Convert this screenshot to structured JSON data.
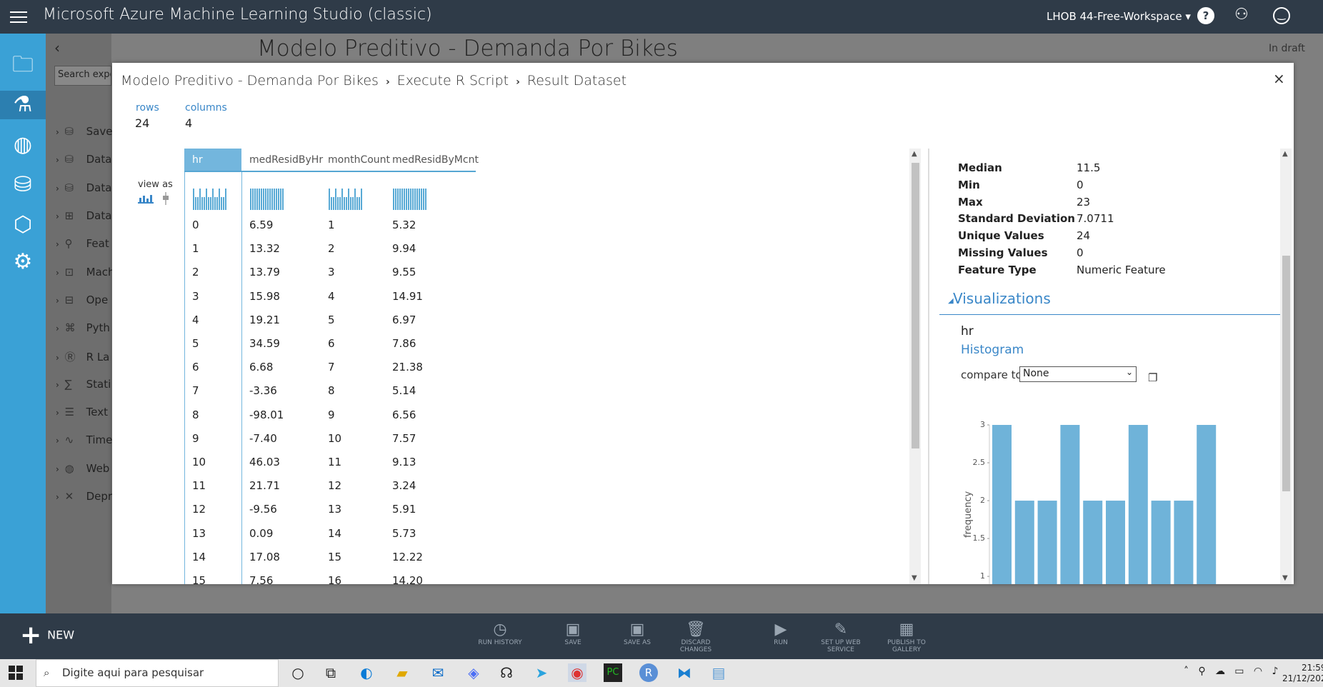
{
  "topbar": {
    "title": "Microsoft Azure Machine Learning Studio (classic)",
    "workspace": "LHOB 44-Free-Workspace ▾"
  },
  "rail": {
    "icons": [
      "projects-icon",
      "experiments-icon",
      "web-services-icon",
      "datasets-icon",
      "trained-models-icon",
      "settings-icon"
    ]
  },
  "palette": {
    "search_placeholder": "Search expe",
    "items": [
      "Save",
      "Data",
      "Data",
      "Data",
      "Feat",
      "Mach",
      "Ope",
      "Pyth",
      "R La",
      "Stati",
      "Text",
      "Time",
      "Web",
      "Depr"
    ]
  },
  "experiment": {
    "title": "Modelo Preditivo - Demanda Por Bikes",
    "status": "In draft"
  },
  "modal": {
    "breadcrumbs": [
      "Modelo Preditivo - Demanda Por Bikes",
      "Execute R Script",
      "Result Dataset"
    ],
    "close": "×",
    "rows_label": "rows",
    "rows_value": "24",
    "columns_label": "columns",
    "columns_value": "4",
    "view_as": "view as",
    "columns": [
      "hr",
      "medResidByHr",
      "monthCount",
      "medResidByMcnt"
    ],
    "rows": [
      [
        "0",
        "6.59",
        "1",
        "5.32"
      ],
      [
        "1",
        "13.32",
        "2",
        "9.94"
      ],
      [
        "2",
        "13.79",
        "3",
        "9.55"
      ],
      [
        "3",
        "15.98",
        "4",
        "14.91"
      ],
      [
        "4",
        "19.21",
        "5",
        "6.97"
      ],
      [
        "5",
        "34.59",
        "6",
        "7.86"
      ],
      [
        "6",
        "6.68",
        "7",
        "21.38"
      ],
      [
        "7",
        "-3.36",
        "8",
        "5.14"
      ],
      [
        "8",
        "-98.01",
        "9",
        "6.56"
      ],
      [
        "9",
        "-7.40",
        "10",
        "7.57"
      ],
      [
        "10",
        "46.03",
        "11",
        "9.13"
      ],
      [
        "11",
        "21.71",
        "12",
        "3.24"
      ],
      [
        "12",
        "-9.56",
        "13",
        "5.91"
      ],
      [
        "13",
        "0.09",
        "14",
        "5.73"
      ],
      [
        "14",
        "17.08",
        "15",
        "12.22"
      ],
      [
        "15",
        "7.56",
        "16",
        "14.20"
      ]
    ],
    "stats": [
      [
        "Median",
        "11.5"
      ],
      [
        "Min",
        "0"
      ],
      [
        "Max",
        "23"
      ],
      [
        "Standard Deviation",
        "7.0711"
      ],
      [
        "Unique Values",
        "24"
      ],
      [
        "Missing Values",
        "0"
      ],
      [
        "Feature Type",
        "Numeric Feature"
      ]
    ],
    "visualizations": "Visualizations",
    "viz_column": "hr",
    "viz_type": "Histogram",
    "compare_label": "compare to",
    "compare_value": "None"
  },
  "chart_data": {
    "type": "bar",
    "title": "",
    "xlabel": "",
    "ylabel": "frequency",
    "values": [
      3,
      2,
      2,
      3,
      2,
      2,
      3,
      2,
      2,
      3
    ],
    "yticks": [
      "1",
      "1.5",
      "2",
      "2.5",
      "3"
    ],
    "ylim_visible": [
      0.85,
      3
    ],
    "color": "#6fb3d9"
  },
  "commands": [
    "RUN HISTORY",
    "SAVE",
    "SAVE AS",
    "DISCARD CHANGES",
    "RUN",
    "SET UP WEB SERVICE",
    "PUBLISH TO GALLERY"
  ],
  "new_button": "NEW",
  "taskbar": {
    "search": "Digite aqui para pesquisar",
    "time": "21:59",
    "date": "21/12/202"
  }
}
